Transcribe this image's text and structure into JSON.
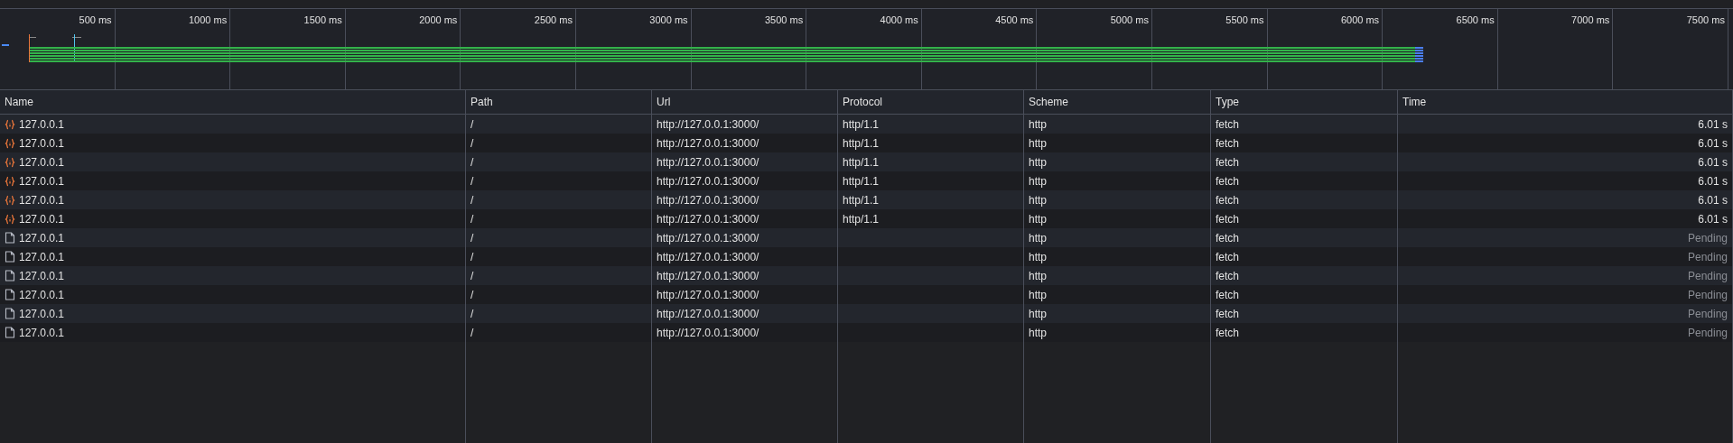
{
  "timeline": {
    "ticks": [
      "500 ms",
      "1000 ms",
      "1500 ms",
      "2000 ms",
      "2500 ms",
      "3000 ms",
      "3500 ms",
      "4000 ms",
      "4500 ms",
      "5000 ms",
      "5500 ms",
      "6000 ms",
      "6500 ms",
      "7000 ms",
      "7500 ms"
    ]
  },
  "table": {
    "columns": [
      "Name",
      "Path",
      "Url",
      "Protocol",
      "Scheme",
      "Type",
      "Time"
    ],
    "rows": [
      {
        "kind": "fetch",
        "name": "127.0.0.1",
        "path": "/",
        "url": "http://127.0.0.1:3000/",
        "protocol": "http/1.1",
        "scheme": "http",
        "type": "fetch",
        "time": "6.01 s",
        "pending": false
      },
      {
        "kind": "fetch",
        "name": "127.0.0.1",
        "path": "/",
        "url": "http://127.0.0.1:3000/",
        "protocol": "http/1.1",
        "scheme": "http",
        "type": "fetch",
        "time": "6.01 s",
        "pending": false
      },
      {
        "kind": "fetch",
        "name": "127.0.0.1",
        "path": "/",
        "url": "http://127.0.0.1:3000/",
        "protocol": "http/1.1",
        "scheme": "http",
        "type": "fetch",
        "time": "6.01 s",
        "pending": false
      },
      {
        "kind": "fetch",
        "name": "127.0.0.1",
        "path": "/",
        "url": "http://127.0.0.1:3000/",
        "protocol": "http/1.1",
        "scheme": "http",
        "type": "fetch",
        "time": "6.01 s",
        "pending": false
      },
      {
        "kind": "fetch",
        "name": "127.0.0.1",
        "path": "/",
        "url": "http://127.0.0.1:3000/",
        "protocol": "http/1.1",
        "scheme": "http",
        "type": "fetch",
        "time": "6.01 s",
        "pending": false
      },
      {
        "kind": "fetch",
        "name": "127.0.0.1",
        "path": "/",
        "url": "http://127.0.0.1:3000/",
        "protocol": "http/1.1",
        "scheme": "http",
        "type": "fetch",
        "time": "6.01 s",
        "pending": false
      },
      {
        "kind": "document",
        "name": "127.0.0.1",
        "path": "/",
        "url": "http://127.0.0.1:3000/",
        "scheme": "http",
        "type": "fetch",
        "time": "Pending",
        "pending": true
      },
      {
        "kind": "document",
        "name": "127.0.0.1",
        "path": "/",
        "url": "http://127.0.0.1:3000/",
        "scheme": "http",
        "type": "fetch",
        "time": "Pending",
        "pending": true
      },
      {
        "kind": "document",
        "name": "127.0.0.1",
        "path": "/",
        "url": "http://127.0.0.1:3000/",
        "scheme": "http",
        "type": "fetch",
        "time": "Pending",
        "pending": true
      },
      {
        "kind": "document",
        "name": "127.0.0.1",
        "path": "/",
        "url": "http://127.0.0.1:3000/",
        "scheme": "http",
        "type": "fetch",
        "time": "Pending",
        "pending": true
      },
      {
        "kind": "document",
        "name": "127.0.0.1",
        "path": "/",
        "url": "http://127.0.0.1:3000/",
        "scheme": "http",
        "type": "fetch",
        "time": "Pending",
        "pending": true
      },
      {
        "kind": "document",
        "name": "127.0.0.1",
        "path": "/",
        "url": "http://127.0.0.1:3000/",
        "scheme": "http",
        "type": "fetch",
        "time": "Pending",
        "pending": true
      }
    ]
  }
}
